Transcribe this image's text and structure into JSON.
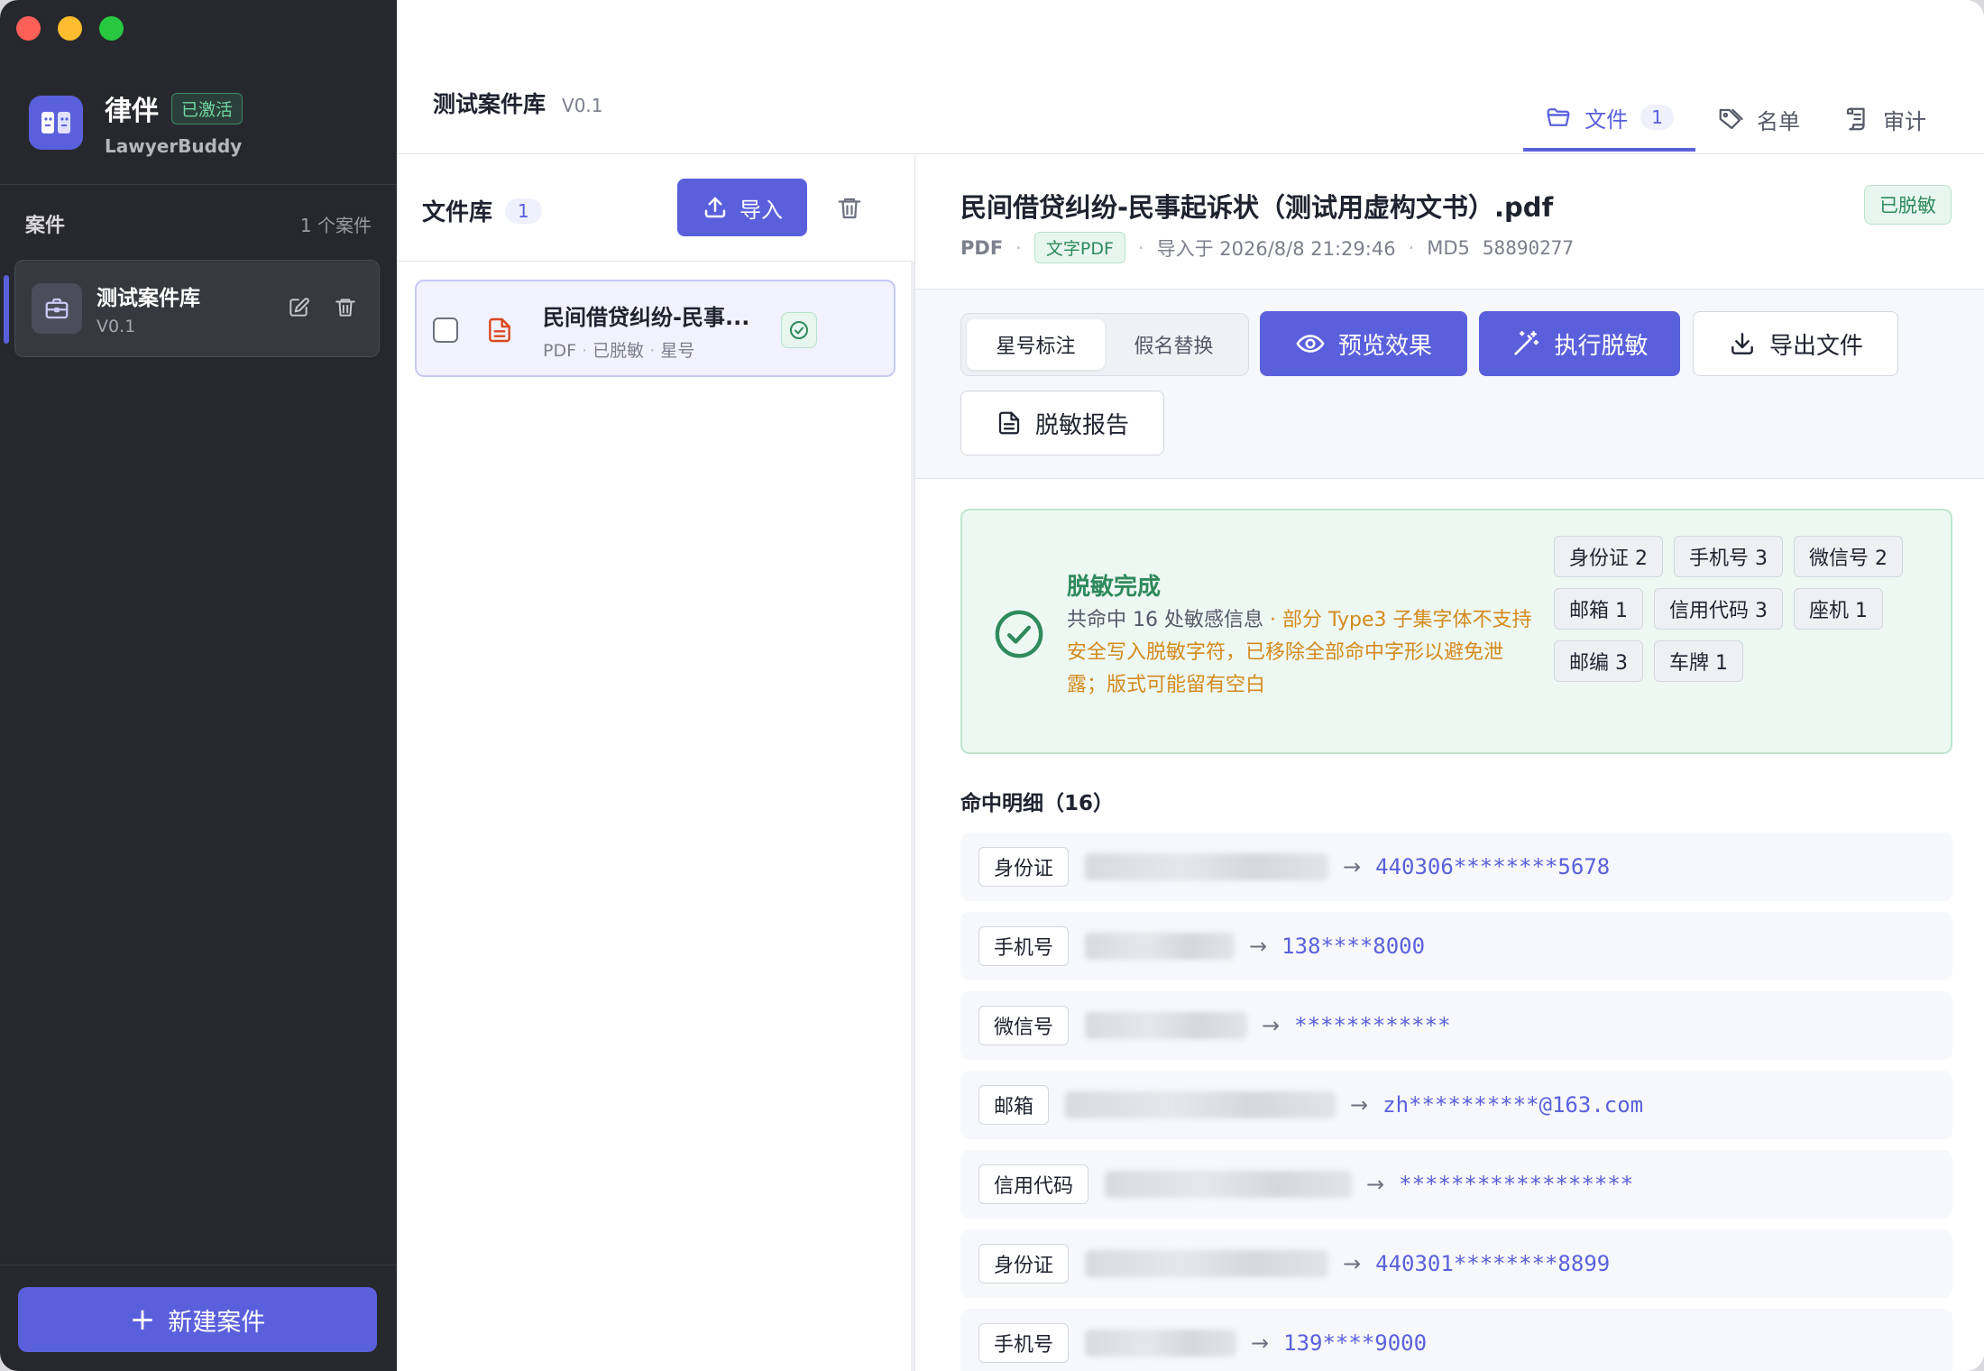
{
  "app": {
    "name": "律伴",
    "subtitle": "LawyerBuddy",
    "activated_badge": "已激活"
  },
  "sidebar": {
    "section_title": "案件",
    "case_count": "1 个案件",
    "cases": [
      {
        "name": "测试案件库",
        "version": "V0.1"
      }
    ],
    "new_case_label": "新建案件"
  },
  "header": {
    "title": "测试案件库",
    "version": "V0.1",
    "tabs": [
      {
        "label": "文件",
        "count": "1"
      },
      {
        "label": "名单"
      },
      {
        "label": "审计"
      }
    ]
  },
  "file_panel": {
    "title": "文件库",
    "count": "1",
    "import_label": "导入",
    "files": [
      {
        "name": "民间借贷纠纷-民事...",
        "type": "PDF",
        "status": "已脱敏",
        "mode": "星号"
      }
    ]
  },
  "detail": {
    "title": "民间借贷纠纷-民事起诉状（测试用虚构文书）.pdf",
    "status_badge": "已脱敏",
    "file_type": "PDF",
    "pdf_kind": "文字PDF",
    "imported_at": "导入于 2026/8/8 21:29:46",
    "md5_label": "MD5",
    "md5": "58890277",
    "modes": [
      "星号标注",
      "假名替换"
    ],
    "active_mode": "星号标注",
    "buttons": {
      "preview": "预览效果",
      "execute": "执行脱敏",
      "export": "导出文件",
      "report": "脱敏报告"
    },
    "result": {
      "title": "脱敏完成",
      "summary": "共命中 16 处敏感信息",
      "warning": " · 部分 Type3 子集字体不支持安全写入脱敏字符，已移除全部命中字形以避免泄露；版式可能留有空白",
      "chips": [
        "身份证 2",
        "手机号 3",
        "微信号 2",
        "邮箱 1",
        "信用代码 3",
        "座机 1",
        "邮编 3",
        "车牌 1"
      ]
    },
    "hits_title": "命中明细（16）",
    "hits": [
      {
        "type": "身份证",
        "masked": "440306********5678"
      },
      {
        "type": "手机号",
        "masked": "138****8000"
      },
      {
        "type": "微信号",
        "masked": "************"
      },
      {
        "type": "邮箱",
        "masked": "zh**********@163.com"
      },
      {
        "type": "信用代码",
        "masked": "******************"
      },
      {
        "type": "身份证",
        "masked": "440301********8899"
      },
      {
        "type": "手机号",
        "masked": "139****9000"
      }
    ]
  },
  "colors": {
    "accent": "#5a60dc",
    "sidebar_bg": "#27282d",
    "success": "#2f8a5c",
    "warning": "#d38a1d"
  }
}
